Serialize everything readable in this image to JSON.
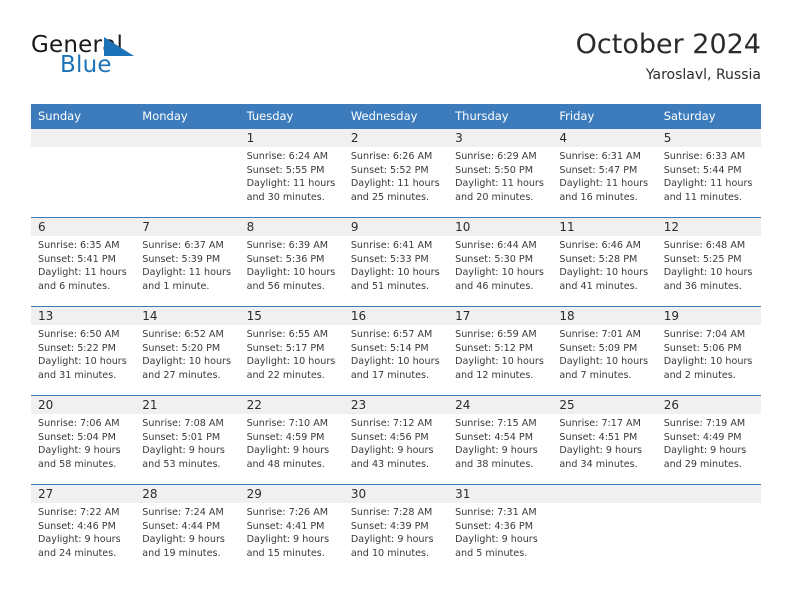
{
  "brand": {
    "name_part1": "General",
    "name_part2": "Blue",
    "logo_icon": "triangle-logo-icon"
  },
  "header": {
    "title": "October 2024",
    "subtitle": "Yaroslavl, Russia"
  },
  "colors": {
    "header_blue": "#3c7cbd",
    "brand_blue": "#1c73b8",
    "daynum_band": "#f0f0f0",
    "text": "#2b2b2b"
  },
  "weekdays": [
    "Sunday",
    "Monday",
    "Tuesday",
    "Wednesday",
    "Thursday",
    "Friday",
    "Saturday"
  ],
  "labels": {
    "sunrise_prefix": "Sunrise:",
    "sunset_prefix": "Sunset:",
    "daylight_prefix": "Daylight:"
  },
  "weeks": [
    [
      {
        "day": "",
        "empty": true
      },
      {
        "day": "",
        "empty": true
      },
      {
        "day": "1",
        "sunrise": "Sunrise: 6:24 AM",
        "sunset": "Sunset: 5:55 PM",
        "daylight_line1": "Daylight: 11 hours",
        "daylight_line2": "and 30 minutes."
      },
      {
        "day": "2",
        "sunrise": "Sunrise: 6:26 AM",
        "sunset": "Sunset: 5:52 PM",
        "daylight_line1": "Daylight: 11 hours",
        "daylight_line2": "and 25 minutes."
      },
      {
        "day": "3",
        "sunrise": "Sunrise: 6:29 AM",
        "sunset": "Sunset: 5:50 PM",
        "daylight_line1": "Daylight: 11 hours",
        "daylight_line2": "and 20 minutes."
      },
      {
        "day": "4",
        "sunrise": "Sunrise: 6:31 AM",
        "sunset": "Sunset: 5:47 PM",
        "daylight_line1": "Daylight: 11 hours",
        "daylight_line2": "and 16 minutes."
      },
      {
        "day": "5",
        "sunrise": "Sunrise: 6:33 AM",
        "sunset": "Sunset: 5:44 PM",
        "daylight_line1": "Daylight: 11 hours",
        "daylight_line2": "and 11 minutes."
      }
    ],
    [
      {
        "day": "6",
        "sunrise": "Sunrise: 6:35 AM",
        "sunset": "Sunset: 5:41 PM",
        "daylight_line1": "Daylight: 11 hours",
        "daylight_line2": "and 6 minutes."
      },
      {
        "day": "7",
        "sunrise": "Sunrise: 6:37 AM",
        "sunset": "Sunset: 5:39 PM",
        "daylight_line1": "Daylight: 11 hours",
        "daylight_line2": "and 1 minute."
      },
      {
        "day": "8",
        "sunrise": "Sunrise: 6:39 AM",
        "sunset": "Sunset: 5:36 PM",
        "daylight_line1": "Daylight: 10 hours",
        "daylight_line2": "and 56 minutes."
      },
      {
        "day": "9",
        "sunrise": "Sunrise: 6:41 AM",
        "sunset": "Sunset: 5:33 PM",
        "daylight_line1": "Daylight: 10 hours",
        "daylight_line2": "and 51 minutes."
      },
      {
        "day": "10",
        "sunrise": "Sunrise: 6:44 AM",
        "sunset": "Sunset: 5:30 PM",
        "daylight_line1": "Daylight: 10 hours",
        "daylight_line2": "and 46 minutes."
      },
      {
        "day": "11",
        "sunrise": "Sunrise: 6:46 AM",
        "sunset": "Sunset: 5:28 PM",
        "daylight_line1": "Daylight: 10 hours",
        "daylight_line2": "and 41 minutes."
      },
      {
        "day": "12",
        "sunrise": "Sunrise: 6:48 AM",
        "sunset": "Sunset: 5:25 PM",
        "daylight_line1": "Daylight: 10 hours",
        "daylight_line2": "and 36 minutes."
      }
    ],
    [
      {
        "day": "13",
        "sunrise": "Sunrise: 6:50 AM",
        "sunset": "Sunset: 5:22 PM",
        "daylight_line1": "Daylight: 10 hours",
        "daylight_line2": "and 31 minutes."
      },
      {
        "day": "14",
        "sunrise": "Sunrise: 6:52 AM",
        "sunset": "Sunset: 5:20 PM",
        "daylight_line1": "Daylight: 10 hours",
        "daylight_line2": "and 27 minutes."
      },
      {
        "day": "15",
        "sunrise": "Sunrise: 6:55 AM",
        "sunset": "Sunset: 5:17 PM",
        "daylight_line1": "Daylight: 10 hours",
        "daylight_line2": "and 22 minutes."
      },
      {
        "day": "16",
        "sunrise": "Sunrise: 6:57 AM",
        "sunset": "Sunset: 5:14 PM",
        "daylight_line1": "Daylight: 10 hours",
        "daylight_line2": "and 17 minutes."
      },
      {
        "day": "17",
        "sunrise": "Sunrise: 6:59 AM",
        "sunset": "Sunset: 5:12 PM",
        "daylight_line1": "Daylight: 10 hours",
        "daylight_line2": "and 12 minutes."
      },
      {
        "day": "18",
        "sunrise": "Sunrise: 7:01 AM",
        "sunset": "Sunset: 5:09 PM",
        "daylight_line1": "Daylight: 10 hours",
        "daylight_line2": "and 7 minutes."
      },
      {
        "day": "19",
        "sunrise": "Sunrise: 7:04 AM",
        "sunset": "Sunset: 5:06 PM",
        "daylight_line1": "Daylight: 10 hours",
        "daylight_line2": "and 2 minutes."
      }
    ],
    [
      {
        "day": "20",
        "sunrise": "Sunrise: 7:06 AM",
        "sunset": "Sunset: 5:04 PM",
        "daylight_line1": "Daylight: 9 hours",
        "daylight_line2": "and 58 minutes."
      },
      {
        "day": "21",
        "sunrise": "Sunrise: 7:08 AM",
        "sunset": "Sunset: 5:01 PM",
        "daylight_line1": "Daylight: 9 hours",
        "daylight_line2": "and 53 minutes."
      },
      {
        "day": "22",
        "sunrise": "Sunrise: 7:10 AM",
        "sunset": "Sunset: 4:59 PM",
        "daylight_line1": "Daylight: 9 hours",
        "daylight_line2": "and 48 minutes."
      },
      {
        "day": "23",
        "sunrise": "Sunrise: 7:12 AM",
        "sunset": "Sunset: 4:56 PM",
        "daylight_line1": "Daylight: 9 hours",
        "daylight_line2": "and 43 minutes."
      },
      {
        "day": "24",
        "sunrise": "Sunrise: 7:15 AM",
        "sunset": "Sunset: 4:54 PM",
        "daylight_line1": "Daylight: 9 hours",
        "daylight_line2": "and 38 minutes."
      },
      {
        "day": "25",
        "sunrise": "Sunrise: 7:17 AM",
        "sunset": "Sunset: 4:51 PM",
        "daylight_line1": "Daylight: 9 hours",
        "daylight_line2": "and 34 minutes."
      },
      {
        "day": "26",
        "sunrise": "Sunrise: 7:19 AM",
        "sunset": "Sunset: 4:49 PM",
        "daylight_line1": "Daylight: 9 hours",
        "daylight_line2": "and 29 minutes."
      }
    ],
    [
      {
        "day": "27",
        "sunrise": "Sunrise: 7:22 AM",
        "sunset": "Sunset: 4:46 PM",
        "daylight_line1": "Daylight: 9 hours",
        "daylight_line2": "and 24 minutes."
      },
      {
        "day": "28",
        "sunrise": "Sunrise: 7:24 AM",
        "sunset": "Sunset: 4:44 PM",
        "daylight_line1": "Daylight: 9 hours",
        "daylight_line2": "and 19 minutes."
      },
      {
        "day": "29",
        "sunrise": "Sunrise: 7:26 AM",
        "sunset": "Sunset: 4:41 PM",
        "daylight_line1": "Daylight: 9 hours",
        "daylight_line2": "and 15 minutes."
      },
      {
        "day": "30",
        "sunrise": "Sunrise: 7:28 AM",
        "sunset": "Sunset: 4:39 PM",
        "daylight_line1": "Daylight: 9 hours",
        "daylight_line2": "and 10 minutes."
      },
      {
        "day": "31",
        "sunrise": "Sunrise: 7:31 AM",
        "sunset": "Sunset: 4:36 PM",
        "daylight_line1": "Daylight: 9 hours",
        "daylight_line2": "and 5 minutes."
      },
      {
        "day": "",
        "empty": true
      },
      {
        "day": "",
        "empty": true
      }
    ]
  ]
}
